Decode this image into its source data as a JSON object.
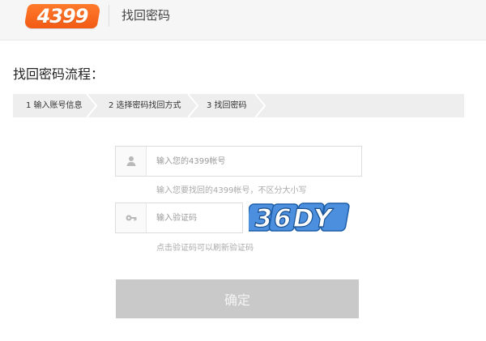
{
  "header": {
    "logo_text": "4399",
    "title": "找回密码"
  },
  "main": {
    "section_title": "找回密码流程：",
    "steps": [
      {
        "label": "1 输入账号信息"
      },
      {
        "label": "2 选择密码找回方式"
      },
      {
        "label": "3 找回密码"
      }
    ],
    "account": {
      "placeholder": "输入您的4399帐号",
      "value": "",
      "hint": "输入您要找回的4399帐号，不区分大小写",
      "icon": "user-icon"
    },
    "captcha": {
      "placeholder": "输入验证码",
      "value": "",
      "hint": "点击验证码可以刷新验证码",
      "icon": "key-icon",
      "code": "36DY"
    },
    "submit_label": "确定"
  },
  "colors": {
    "brand": "#f25a14",
    "disabled_button": "#c9c9c9",
    "captcha_blue": "#2f7ed8"
  }
}
